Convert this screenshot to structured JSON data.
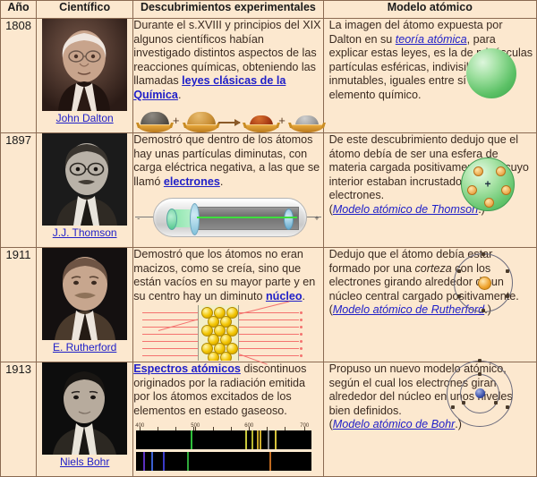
{
  "table": {
    "headers": [
      "Año",
      "Científico",
      "Descubrimientos experimentales",
      "Modelo atómico"
    ],
    "rows": [
      {
        "year": "1808",
        "scientist": "John Dalton",
        "portrait_alt": "john-dalton-portrait",
        "discovery": {
          "t1": "Durante el s.XVIII y principios del XIX algunos científicos habían investigado distintos aspectos de las reacciones químicas, obteniendo las llamadas ",
          "link1": "leyes clásicas de la Química",
          "t2": ".",
          "figure": "chemical-reaction-piles"
        },
        "model": {
          "t1": "La imagen del átomo expuesta por Dalton en su ",
          "link1": "teoría atómica",
          "t2": ", para explicar estas leyes, es la de minúsculas partículas esféricas, indivisibles e inmutables, iguales entre sí en cada elemento químico.",
          "figure": "solid-green-sphere"
        }
      },
      {
        "year": "1897",
        "scientist": "J.J. Thomson",
        "portrait_alt": "jj-thomson-portrait",
        "discovery": {
          "t1": "Demostró que dentro de los átomos hay unas partículas diminutas, con carga eléctrica negativa, a las que se llamó ",
          "link1": "electrones",
          "t2": ".",
          "figure": "cathode-ray-tube"
        },
        "model": {
          "t1": "De este descubrimiento dedujo que el átomo debía de ser una esfera de materia cargada positivamente, en cuyo interior estaban incrustados los electrones.",
          "paren_open": "(",
          "link1": "Modelo atómico de Thomson",
          "paren_close": ".)",
          "figure": "plum-pudding-model"
        }
      },
      {
        "year": "1911",
        "scientist": "E. Rutherford",
        "portrait_alt": "ernest-rutherford-portrait",
        "discovery": {
          "t1": "Demostró que los átomos no eran macizos, como se creía, sino que están vacíos en su mayor parte y en su centro hay un diminuto ",
          "link1": "núcleo",
          "t2": ".",
          "figure": "gold-foil-experiment"
        },
        "model": {
          "t1": "Dedujo que el átomo debía estar formado por una ",
          "italic1": "corteza",
          "t2": " con los electrones girando alrededor de un núcleo central cargado positivamente.",
          "paren_open": "(",
          "link1": "Modelo atómico de Rutherford",
          "paren_close": ".)",
          "figure": "rutherford-orbit-model"
        }
      },
      {
        "year": "1913",
        "scientist": "Niels Bohr",
        "portrait_alt": "niels-bohr-portrait",
        "discovery": {
          "link1": "Espectros atómicos",
          "t1": " discontinuos originados por la radiación emitida por los átomos excitados de los elementos en estado gaseoso.",
          "figure": "emission-absorption-spectra"
        },
        "model": {
          "t1": "Propuso un nuevo modelo atómico, según el cual los electrones giran alrededor del núcleo en unos niveles bien definidos.",
          "paren_open": "(",
          "link1": "Modelo atómico de Bohr",
          "paren_close": ".)",
          "figure": "bohr-shell-model"
        }
      }
    ]
  },
  "spectrum": {
    "tick_labels": [
      "400",
      "500",
      "600",
      "700"
    ],
    "emission_lines": [
      {
        "pos_pct": 31,
        "color": "#2fbf3a"
      },
      {
        "pos_pct": 62,
        "color": "#c8c83a"
      },
      {
        "pos_pct": 65.5,
        "color": "#b8b82f"
      },
      {
        "pos_pct": 69,
        "color": "#c7a62a"
      },
      {
        "pos_pct": 70.5,
        "color": "#cfae2e"
      },
      {
        "pos_pct": 75,
        "color": "#8b8b8b"
      },
      {
        "pos_pct": 79,
        "color": "#d6c23a"
      }
    ],
    "absorption_lines": [
      {
        "pos_pct": 4,
        "color": "#5a2fbf"
      },
      {
        "pos_pct": 8.5,
        "color": "#3a5fd0"
      },
      {
        "pos_pct": 15,
        "color": "#3a3ac8"
      },
      {
        "pos_pct": 29,
        "color": "#2fa83a"
      },
      {
        "pos_pct": 76,
        "color": "#c06a20"
      }
    ]
  },
  "colors": {
    "page_background": "#fce8cf",
    "border": "#8a6a52",
    "link": "#2020c8",
    "body_text": "#3a2a20",
    "header_text": "#1a1a1a",
    "dalton_sphere": "#5cc166",
    "ray_red": "#f4726f",
    "gold_atom": "#f2c400"
  }
}
